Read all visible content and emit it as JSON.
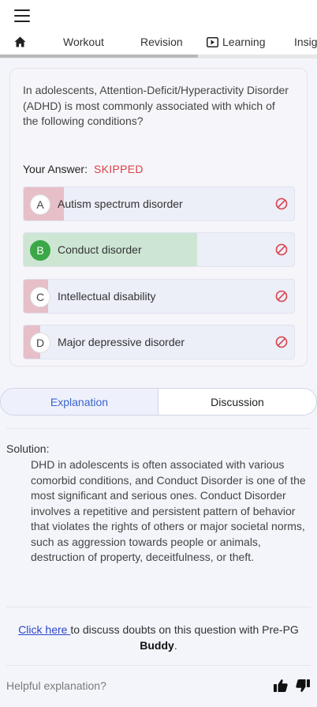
{
  "nav": {
    "tabs": [
      {
        "label": "",
        "icon": "home-icon"
      },
      {
        "label": "Workout"
      },
      {
        "label": "Revision"
      },
      {
        "label": "Learning",
        "icon": "play-icon"
      },
      {
        "label": "Insig"
      }
    ]
  },
  "question": {
    "text": "In adolescents, Attention-Deficit/Hyperactivity Disorder (ADHD) is most commonly associated with which of the following conditions?",
    "your_answer_label": "Your Answer:",
    "your_answer_value": "SKIPPED",
    "options": [
      {
        "letter": "A",
        "text": "Autism spectrum disorder",
        "correct": false,
        "fill_fraction": 0.15,
        "icon": "ban-icon"
      },
      {
        "letter": "B",
        "text": "Conduct disorder",
        "correct": true,
        "fill_fraction": 0.64,
        "icon": "ban-icon"
      },
      {
        "letter": "C",
        "text": "Intellectual disability",
        "correct": false,
        "fill_fraction": 0.09,
        "icon": "ban-icon"
      },
      {
        "letter": "D",
        "text": "Major depressive disorder",
        "correct": false,
        "fill_fraction": 0.06,
        "icon": "ban-icon"
      }
    ]
  },
  "segment": {
    "explanation": "Explanation",
    "discussion": "Discussion",
    "active": "explanation"
  },
  "solution": {
    "title": "Solution:",
    "body": "DHD in adolescents is often associated with various comorbid conditions, and Conduct Disorder is one of the most significant and serious ones. Conduct Disorder involves a repetitive and persistent pattern of behavior that violates the rights of others or major societal norms, such as aggression towards people or animals, destruction of property, deceitfulness, or theft."
  },
  "discuss": {
    "link": "Click here ",
    "text": "to discuss doubts on this question with Pre-PG ",
    "brand": "Buddy",
    "end": "."
  },
  "feedback": {
    "label": "Helpful explanation?"
  },
  "colors": {
    "accent": "#3b64d0",
    "correct": "#3aa846",
    "correct_fill": "#cde6d4",
    "wrong_fill": "#e6bfc9",
    "skipped": "#d9414a",
    "link": "#2b45c9"
  }
}
